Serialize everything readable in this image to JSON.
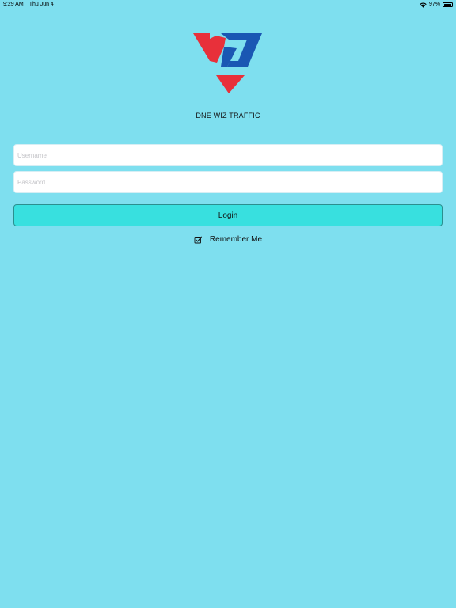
{
  "status_bar": {
    "time": "9:29 AM",
    "date": "Thu Jun 4",
    "battery_percent": "97%",
    "battery_level": 0.97,
    "wifi_icon": "wifi-icon",
    "battery_icon": "battery-icon"
  },
  "app": {
    "title": "DNE WIZ TRAFFIC",
    "logo_colors": {
      "red": "#e8303a",
      "blue": "#1a57b3"
    }
  },
  "login_form": {
    "username_placeholder": "Username",
    "username_value": "",
    "password_placeholder": "Password",
    "password_value": "",
    "login_label": "Login",
    "remember_me_label": "Remember Me",
    "remember_me_checked": true
  },
  "colors": {
    "background": "#7edfef",
    "button": "#38e0df",
    "button_border": "#2b8f8f"
  }
}
